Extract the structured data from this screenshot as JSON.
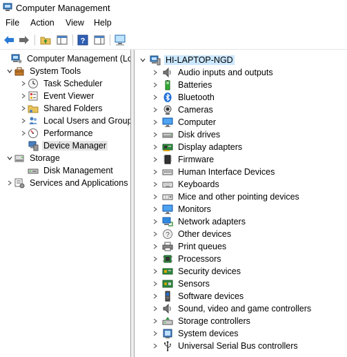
{
  "window": {
    "title": "Computer Management"
  },
  "menu": [
    "File",
    "Action",
    "View",
    "Help"
  ],
  "toolbar": {
    "buttons": [
      "back-icon",
      "forward-icon",
      "up-folder-icon",
      "show-hide-tree-icon",
      "help-icon",
      "properties-pane-icon",
      "monitor-icon"
    ]
  },
  "left_tree": [
    {
      "label": "Computer Management (Local",
      "icon": "computer-management-icon",
      "level": 0,
      "expander": ""
    },
    {
      "label": "System Tools",
      "icon": "toolbox-icon",
      "level": 1,
      "expander": "open"
    },
    {
      "label": "Task Scheduler",
      "icon": "clock-icon",
      "level": 2,
      "expander": "closed"
    },
    {
      "label": "Event Viewer",
      "icon": "event-viewer-icon",
      "level": 2,
      "expander": "closed"
    },
    {
      "label": "Shared Folders",
      "icon": "shared-folder-icon",
      "level": 2,
      "expander": "closed"
    },
    {
      "label": "Local Users and Groups",
      "icon": "users-icon",
      "level": 2,
      "expander": "closed"
    },
    {
      "label": "Performance",
      "icon": "performance-icon",
      "level": 2,
      "expander": "closed"
    },
    {
      "label": "Device Manager",
      "icon": "device-manager-icon",
      "level": 2,
      "expander": "",
      "selected": true
    },
    {
      "label": "Storage",
      "icon": "storage-icon",
      "level": 1,
      "expander": "open"
    },
    {
      "label": "Disk Management",
      "icon": "disk-management-icon",
      "level": 2,
      "expander": ""
    },
    {
      "label": "Services and Applications",
      "icon": "services-icon",
      "level": 1,
      "expander": "closed"
    }
  ],
  "right_tree": {
    "root": {
      "label": "HI-LAPTOP-NGD",
      "icon": "computer-icon"
    },
    "items": [
      {
        "label": "Audio inputs and outputs",
        "icon": "speaker-icon"
      },
      {
        "label": "Batteries",
        "icon": "battery-icon"
      },
      {
        "label": "Bluetooth",
        "icon": "bluetooth-icon"
      },
      {
        "label": "Cameras",
        "icon": "camera-icon"
      },
      {
        "label": "Computer",
        "icon": "monitor-icon"
      },
      {
        "label": "Disk drives",
        "icon": "disk-drive-icon"
      },
      {
        "label": "Display adapters",
        "icon": "display-adapter-icon"
      },
      {
        "label": "Firmware",
        "icon": "firmware-icon"
      },
      {
        "label": "Human Interface Devices",
        "icon": "hid-icon"
      },
      {
        "label": "Keyboards",
        "icon": "keyboard-icon"
      },
      {
        "label": "Mice and other pointing devices",
        "icon": "mouse-icon"
      },
      {
        "label": "Monitors",
        "icon": "monitor-icon"
      },
      {
        "label": "Network adapters",
        "icon": "network-adapter-icon"
      },
      {
        "label": "Other devices",
        "icon": "unknown-device-icon"
      },
      {
        "label": "Print queues",
        "icon": "printer-icon"
      },
      {
        "label": "Processors",
        "icon": "processor-icon"
      },
      {
        "label": "Security devices",
        "icon": "security-device-icon"
      },
      {
        "label": "Sensors",
        "icon": "sensor-icon"
      },
      {
        "label": "Software devices",
        "icon": "software-device-icon"
      },
      {
        "label": "Sound, video and game controllers",
        "icon": "speaker-icon"
      },
      {
        "label": "Storage controllers",
        "icon": "storage-controller-icon"
      },
      {
        "label": "System devices",
        "icon": "system-device-icon"
      },
      {
        "label": "Universal Serial Bus controllers",
        "icon": "usb-icon"
      }
    ]
  },
  "colors": {
    "accent": "#0078d7",
    "selection": "#cce8ff",
    "tree_selection": "#e5e5e5"
  }
}
